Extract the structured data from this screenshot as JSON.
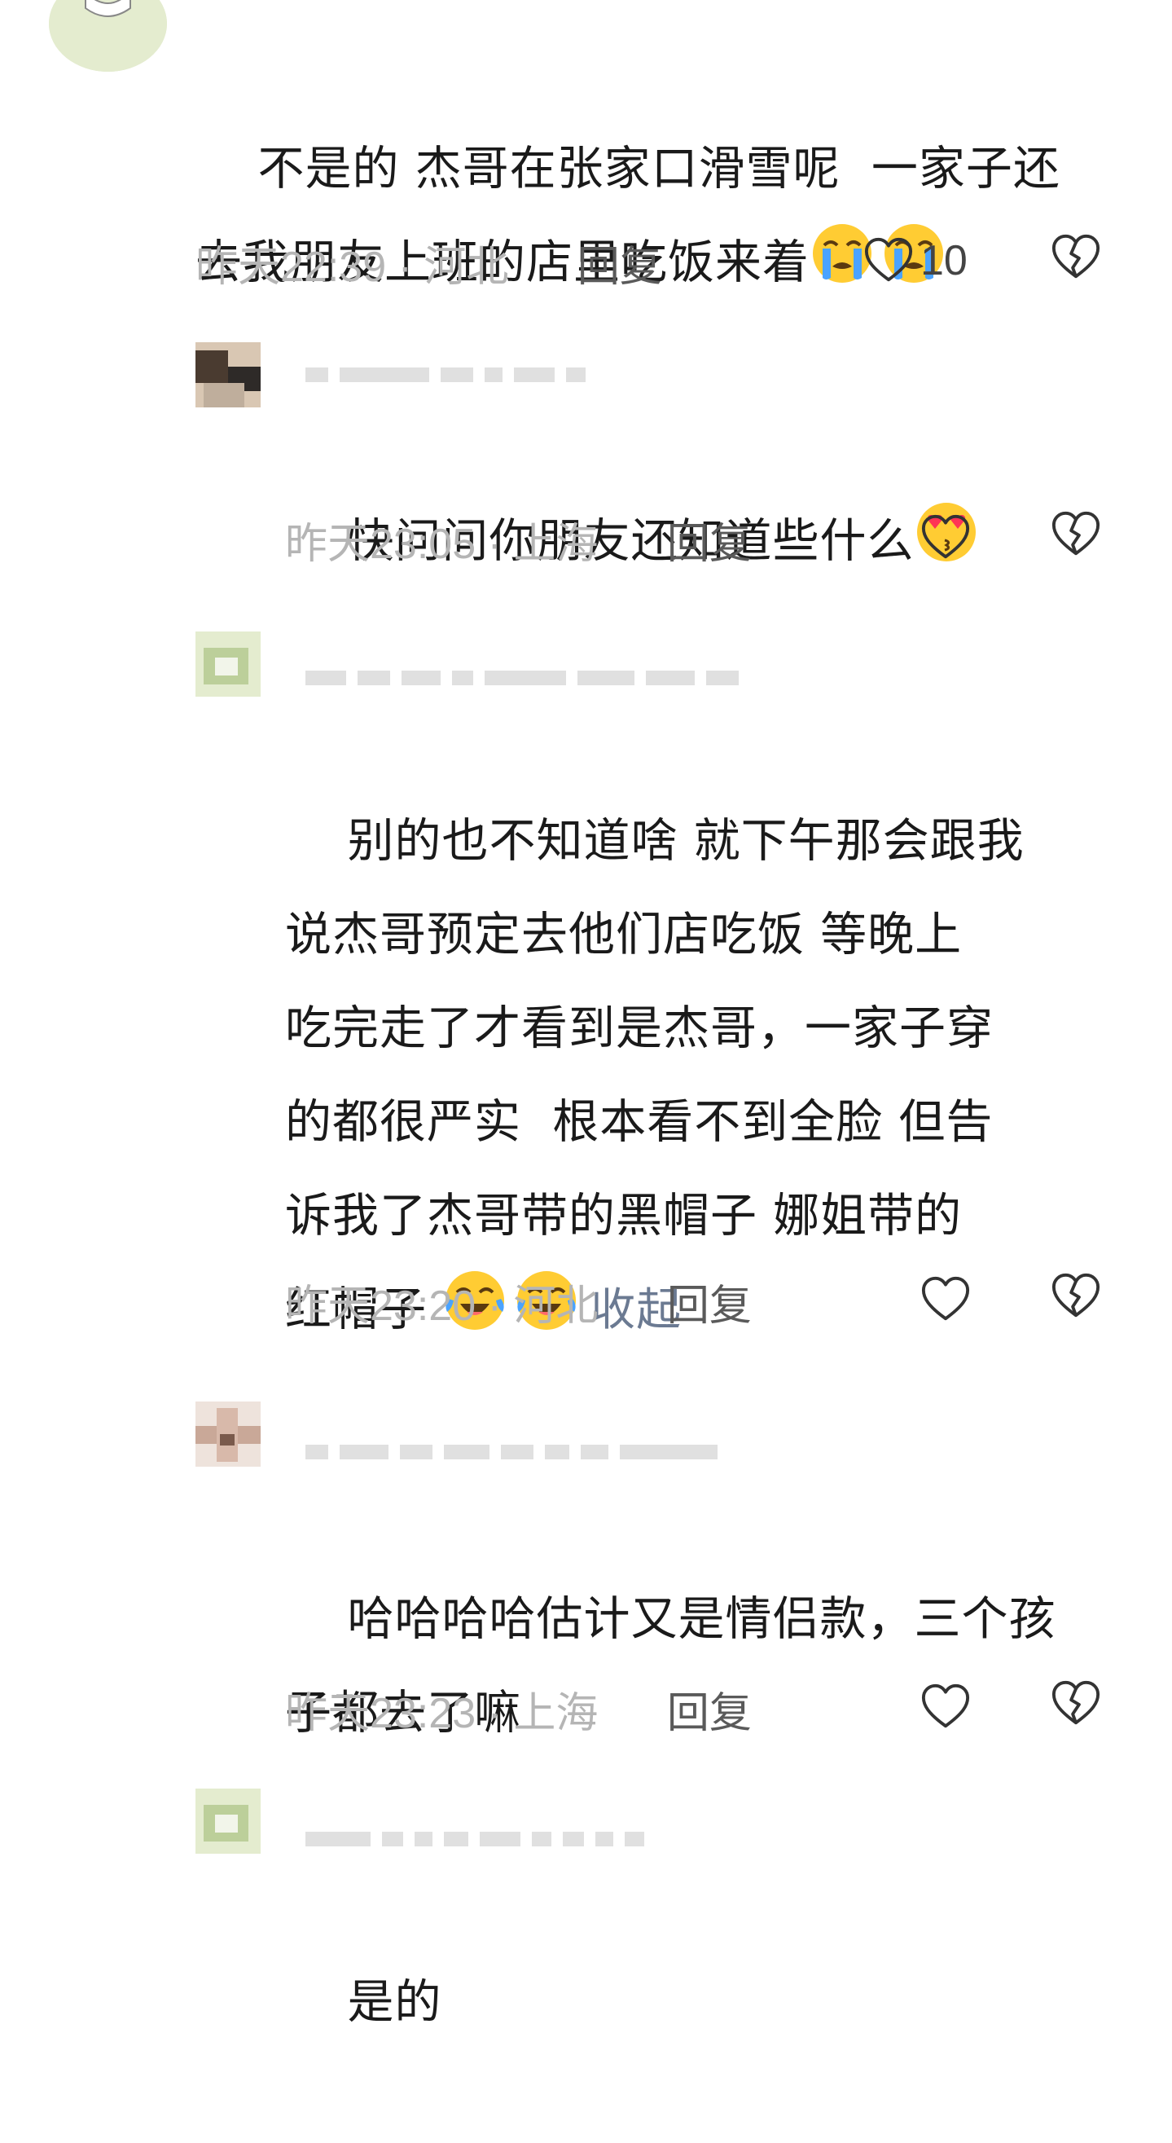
{
  "comments": [
    {
      "text": "不是的 杰哥在张家口滑雪呢  一家子还\n去我朋友上班的店里吃饭来着",
      "emojis": [
        "loudly-crying",
        "loudly-crying"
      ],
      "time": "昨天22:39",
      "separator": "·",
      "location": "河北",
      "reply_label": "回复",
      "like_count": "10"
    },
    {
      "text": "快问问你朋友还知道些什么",
      "emojis": [
        "heart-eyes-kiss"
      ],
      "time": "昨天23:05",
      "separator": "·",
      "location": "上海",
      "reply_label": "回复",
      "like_count": ""
    },
    {
      "text": "别的也不知道啥 就下午那会跟我\n说杰哥预定去他们店吃饭 等晚上\n吃完走了才看到是杰哥，一家子穿\n的都很严实  根本看不到全脸 但告\n诉我了杰哥带的黑帽子 娜姐带的\n红帽子 ",
      "emojis": [
        "tears-of-joy",
        "tears-of-joy"
      ],
      "collapse_label": "收起",
      "time": "昨天23:20",
      "separator": "·",
      "location": "河北",
      "reply_label": "回复",
      "like_count": ""
    },
    {
      "text": "哈哈哈哈估计又是情侣款，三个孩\n子都去了嘛",
      "emojis": [],
      "time": "昨天23:23",
      "separator": "·",
      "location": "上海",
      "reply_label": "回复",
      "like_count": ""
    },
    {
      "text": "是的",
      "emojis": [],
      "time": "",
      "separator": "",
      "location": "",
      "reply_label": "",
      "like_count": ""
    }
  ],
  "icons": {
    "like": "heart-outline-icon",
    "dislike": "broken-heart-icon"
  },
  "colors": {
    "text": "#1a1a1a",
    "meta": "#b5b5b5",
    "reply": "#5a5a5a",
    "collapse": "#6b7a92",
    "icon": "#333333"
  }
}
